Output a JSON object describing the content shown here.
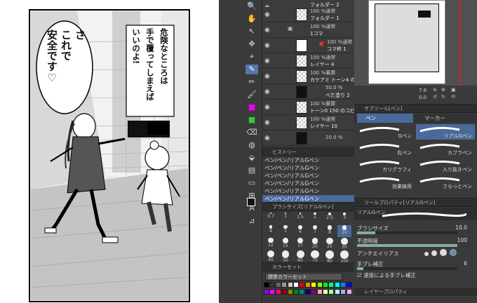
{
  "manga": {
    "bubble_left": [
      "さ",
      "これで",
      "安全です♡"
    ],
    "bubble_right": [
      "危険なところは",
      "手で覆ってしまえば",
      "いいのよ!"
    ]
  },
  "layers": [
    {
      "sub": "",
      "name": "フォルダー 2"
    },
    {
      "sub": "100 %通常",
      "name": "フォルダー 1"
    },
    {
      "sub": "100 %通常",
      "name": "1コマ"
    },
    {
      "sub": "100 %通常",
      "name": "コマ枠 1"
    },
    {
      "sub": "100 %通常",
      "name": "レイヤー 4"
    },
    {
      "sub": "100 %乗算",
      "name": "カケアミ トーン4 のコピー"
    },
    {
      "sub": "50.0 %",
      "name": "べた塗り 2"
    },
    {
      "sub": "100 %乗算",
      "name": "トーン0 150 のコピー"
    },
    {
      "sub": "100 %通常",
      "name": "レイヤー 10"
    },
    {
      "sub": "20.0 %",
      "name": ""
    }
  ],
  "history": {
    "title": "ヒストリー",
    "items": [
      "ペン/ペン/リアルGペン",
      "ペン/ペン/リアルGペン",
      "ペン/ペン/リアルGペン",
      "ペン/ペン/リアルGペン",
      "ペン/ペン/リアルGペン",
      "ペン/ペン/リアルGペン"
    ]
  },
  "brushsize": {
    "title": "ブラシサイズ[リアルGペン]",
    "sizes": [
      "0.7",
      "1",
      "1.5",
      "2",
      "2.5",
      "3",
      "4",
      "5",
      "6",
      "7",
      "8",
      "10",
      "12",
      "15",
      "17",
      "20",
      "25",
      "30",
      "40",
      "50",
      "60",
      "70",
      "80",
      "100"
    ]
  },
  "colorset": {
    "title": "カラーセット",
    "select": "標準カラーセット"
  },
  "navigator": {
    "zoom": "7.8",
    "angle": "0.0"
  },
  "subtool": {
    "title": "サブツール[ペン]",
    "tabs": [
      "ペン",
      "マーカー"
    ],
    "brushes": [
      "Gペン",
      "リアルGペン",
      "丸ペン",
      "カブラペン",
      "カリグラフィ",
      "入り抜きペン",
      "効果線用",
      "さらっとペン"
    ]
  },
  "toolprop": {
    "title": "ツールプロパティ[リアルGペン]",
    "name": "リアルGペン",
    "brush_size_label": "ブラシサイズ",
    "brush_size": "10.0",
    "opacity_label": "不透明度",
    "opacity": "100",
    "aa_label": "アンチエイリアス",
    "stab_label": "手ブレ補正",
    "stab": "6",
    "speed_label": "速度による手ブレ補正",
    "bottom_title": "レイヤープロパティ"
  }
}
